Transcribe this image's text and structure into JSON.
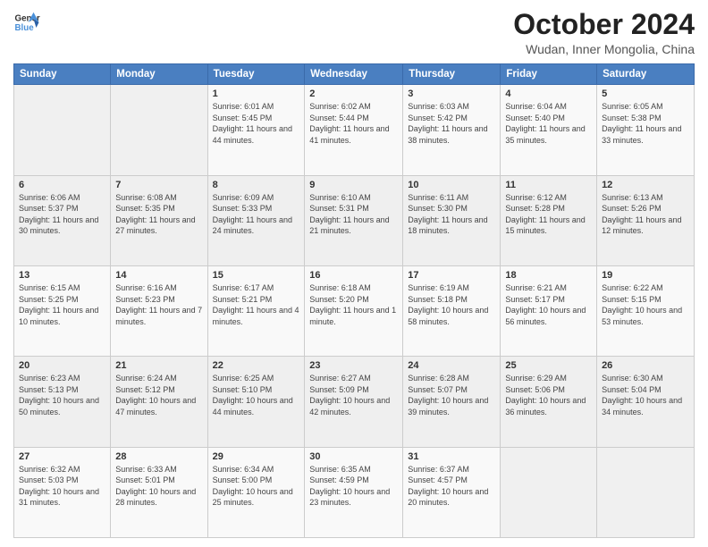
{
  "logo": {
    "line1": "General",
    "line2": "Blue",
    "icon_color": "#4a90d9"
  },
  "title": "October 2024",
  "subtitle": "Wudan, Inner Mongolia, China",
  "header": {
    "days": [
      "Sunday",
      "Monday",
      "Tuesday",
      "Wednesday",
      "Thursday",
      "Friday",
      "Saturday"
    ]
  },
  "weeks": [
    [
      {
        "day": "",
        "detail": ""
      },
      {
        "day": "",
        "detail": ""
      },
      {
        "day": "1",
        "detail": "Sunrise: 6:01 AM\nSunset: 5:45 PM\nDaylight: 11 hours and 44 minutes."
      },
      {
        "day": "2",
        "detail": "Sunrise: 6:02 AM\nSunset: 5:44 PM\nDaylight: 11 hours and 41 minutes."
      },
      {
        "day": "3",
        "detail": "Sunrise: 6:03 AM\nSunset: 5:42 PM\nDaylight: 11 hours and 38 minutes."
      },
      {
        "day": "4",
        "detail": "Sunrise: 6:04 AM\nSunset: 5:40 PM\nDaylight: 11 hours and 35 minutes."
      },
      {
        "day": "5",
        "detail": "Sunrise: 6:05 AM\nSunset: 5:38 PM\nDaylight: 11 hours and 33 minutes."
      }
    ],
    [
      {
        "day": "6",
        "detail": "Sunrise: 6:06 AM\nSunset: 5:37 PM\nDaylight: 11 hours and 30 minutes."
      },
      {
        "day": "7",
        "detail": "Sunrise: 6:08 AM\nSunset: 5:35 PM\nDaylight: 11 hours and 27 minutes."
      },
      {
        "day": "8",
        "detail": "Sunrise: 6:09 AM\nSunset: 5:33 PM\nDaylight: 11 hours and 24 minutes."
      },
      {
        "day": "9",
        "detail": "Sunrise: 6:10 AM\nSunset: 5:31 PM\nDaylight: 11 hours and 21 minutes."
      },
      {
        "day": "10",
        "detail": "Sunrise: 6:11 AM\nSunset: 5:30 PM\nDaylight: 11 hours and 18 minutes."
      },
      {
        "day": "11",
        "detail": "Sunrise: 6:12 AM\nSunset: 5:28 PM\nDaylight: 11 hours and 15 minutes."
      },
      {
        "day": "12",
        "detail": "Sunrise: 6:13 AM\nSunset: 5:26 PM\nDaylight: 11 hours and 12 minutes."
      }
    ],
    [
      {
        "day": "13",
        "detail": "Sunrise: 6:15 AM\nSunset: 5:25 PM\nDaylight: 11 hours and 10 minutes."
      },
      {
        "day": "14",
        "detail": "Sunrise: 6:16 AM\nSunset: 5:23 PM\nDaylight: 11 hours and 7 minutes."
      },
      {
        "day": "15",
        "detail": "Sunrise: 6:17 AM\nSunset: 5:21 PM\nDaylight: 11 hours and 4 minutes."
      },
      {
        "day": "16",
        "detail": "Sunrise: 6:18 AM\nSunset: 5:20 PM\nDaylight: 11 hours and 1 minute."
      },
      {
        "day": "17",
        "detail": "Sunrise: 6:19 AM\nSunset: 5:18 PM\nDaylight: 10 hours and 58 minutes."
      },
      {
        "day": "18",
        "detail": "Sunrise: 6:21 AM\nSunset: 5:17 PM\nDaylight: 10 hours and 56 minutes."
      },
      {
        "day": "19",
        "detail": "Sunrise: 6:22 AM\nSunset: 5:15 PM\nDaylight: 10 hours and 53 minutes."
      }
    ],
    [
      {
        "day": "20",
        "detail": "Sunrise: 6:23 AM\nSunset: 5:13 PM\nDaylight: 10 hours and 50 minutes."
      },
      {
        "day": "21",
        "detail": "Sunrise: 6:24 AM\nSunset: 5:12 PM\nDaylight: 10 hours and 47 minutes."
      },
      {
        "day": "22",
        "detail": "Sunrise: 6:25 AM\nSunset: 5:10 PM\nDaylight: 10 hours and 44 minutes."
      },
      {
        "day": "23",
        "detail": "Sunrise: 6:27 AM\nSunset: 5:09 PM\nDaylight: 10 hours and 42 minutes."
      },
      {
        "day": "24",
        "detail": "Sunrise: 6:28 AM\nSunset: 5:07 PM\nDaylight: 10 hours and 39 minutes."
      },
      {
        "day": "25",
        "detail": "Sunrise: 6:29 AM\nSunset: 5:06 PM\nDaylight: 10 hours and 36 minutes."
      },
      {
        "day": "26",
        "detail": "Sunrise: 6:30 AM\nSunset: 5:04 PM\nDaylight: 10 hours and 34 minutes."
      }
    ],
    [
      {
        "day": "27",
        "detail": "Sunrise: 6:32 AM\nSunset: 5:03 PM\nDaylight: 10 hours and 31 minutes."
      },
      {
        "day": "28",
        "detail": "Sunrise: 6:33 AM\nSunset: 5:01 PM\nDaylight: 10 hours and 28 minutes."
      },
      {
        "day": "29",
        "detail": "Sunrise: 6:34 AM\nSunset: 5:00 PM\nDaylight: 10 hours and 25 minutes."
      },
      {
        "day": "30",
        "detail": "Sunrise: 6:35 AM\nSunset: 4:59 PM\nDaylight: 10 hours and 23 minutes."
      },
      {
        "day": "31",
        "detail": "Sunrise: 6:37 AM\nSunset: 4:57 PM\nDaylight: 10 hours and 20 minutes."
      },
      {
        "day": "",
        "detail": ""
      },
      {
        "day": "",
        "detail": ""
      }
    ]
  ]
}
